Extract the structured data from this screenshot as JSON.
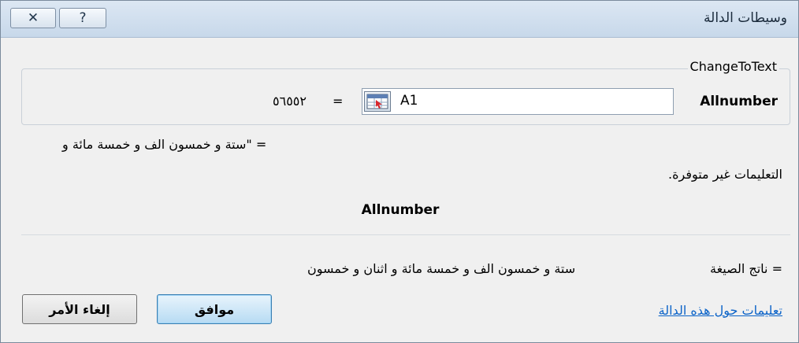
{
  "window": {
    "title": "وسيطات الدالة",
    "close_icon_glyph": "✕",
    "help_icon_glyph": "?"
  },
  "function": {
    "name": "ChangeToText",
    "preview": "= \"ستة و خمسون الف و خمسة مائة و",
    "description": "التعليمات غير متوفرة.",
    "param_description_name": "Allnumber"
  },
  "argument": {
    "label": "Allnumber",
    "value": "A1",
    "equals": "=",
    "evaluated": "٥٦٥٥٢"
  },
  "result": {
    "label": "ناتج الصيغة =",
    "value": "ستة و خمسون الف و خمسة مائة و اثنان و خمسون"
  },
  "footer": {
    "help_link": "تعليمات حول هذه الدالة",
    "ok_label": "موافق",
    "cancel_label": "إلغاء الأمر"
  },
  "colors": {
    "titlebar": "#c7d8ea",
    "link": "#0b63c8",
    "ok_button": "#b7dbf3"
  }
}
